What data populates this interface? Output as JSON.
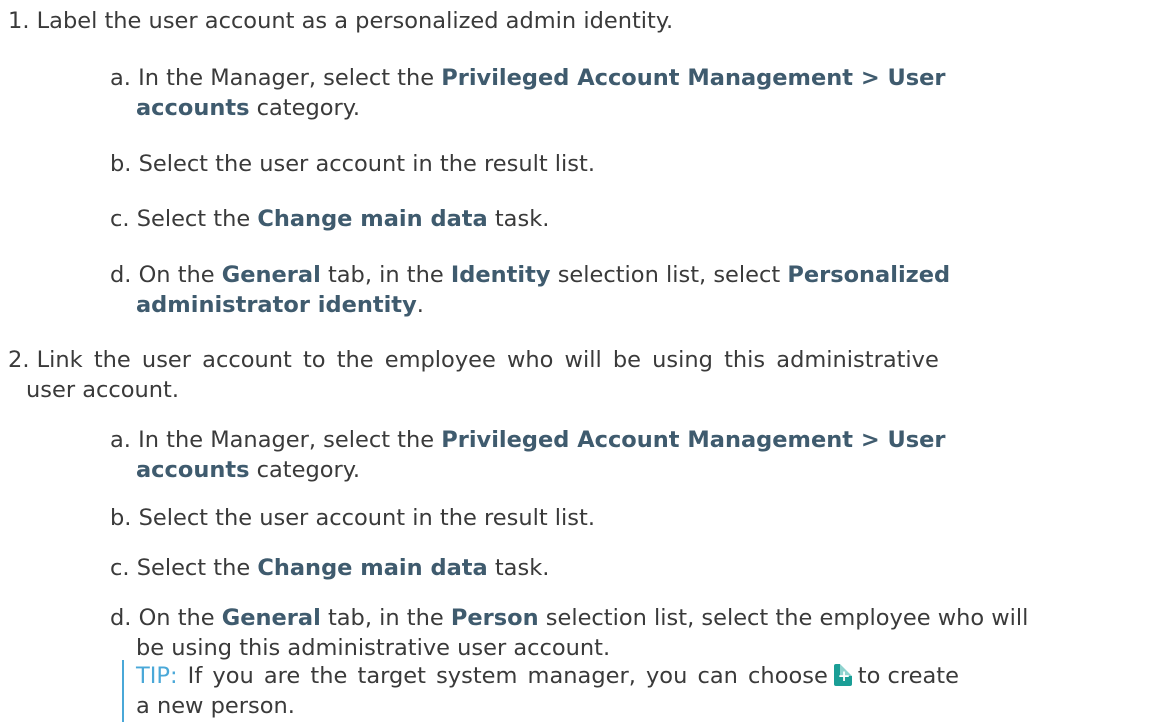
{
  "step1": {
    "number": "1.",
    "text": "Label the user account as a personalized admin identity.",
    "a": {
      "letter": "a.",
      "t1": "In the Manager, select the ",
      "b1": "Privileged Account Management > User",
      "b2": "accounts",
      "t2": " category."
    },
    "b": {
      "letter": "b.",
      "text": "Select the user account in the result list."
    },
    "c": {
      "letter": "c.",
      "t1": "Select the ",
      "b1": "Change main data",
      "t2": " task."
    },
    "d": {
      "letter": "d.",
      "t1": "On the ",
      "b1": "General",
      "t2": " tab, in the ",
      "b2": "Identity",
      "t3": " selection list, select ",
      "b3": "Personalized",
      "b4": "administrator identity",
      "t4": "."
    }
  },
  "step2": {
    "number": "2.",
    "line1": "Link the user account to the employee who will be using this administrative",
    "line2": "user account.",
    "a": {
      "letter": "a.",
      "t1": "In the Manager, select the ",
      "b1": "Privileged Account Management > User",
      "b2": "accounts",
      "t2": " category."
    },
    "b": {
      "letter": "b.",
      "text": "Select the user account in the result list."
    },
    "c": {
      "letter": "c.",
      "t1": "Select the ",
      "b1": "Change main data",
      "t2": " task."
    },
    "d": {
      "letter": "d.",
      "t1": "On the ",
      "b1": "General",
      "t2": " tab, in the ",
      "b2": "Person",
      "t3": " selection list, select the employee who will",
      "line2": "be using this administrative user account."
    },
    "tip": {
      "label": "TIP:",
      "t1": " If you are the target system manager, you can choose",
      "t2": "to create",
      "line2": "a new person.",
      "icon": "create-person-icon",
      "accent": "#4aa8d8"
    }
  }
}
